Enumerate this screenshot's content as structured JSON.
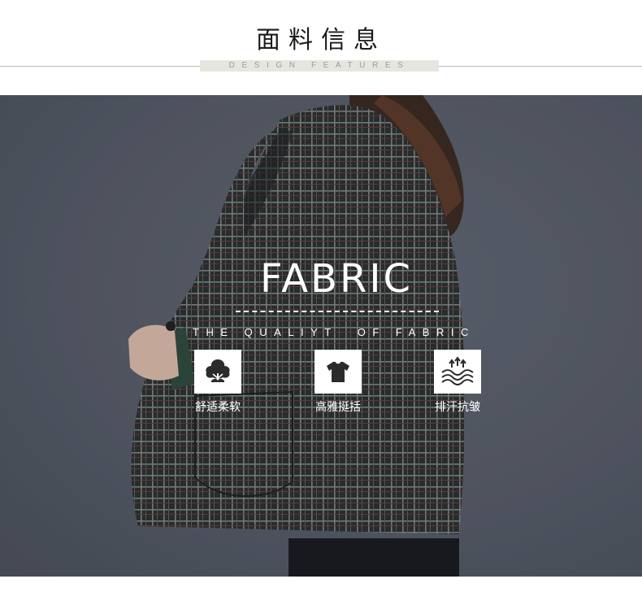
{
  "header": {
    "title": "面料信息",
    "subtitle": "DESIGN FEATURES"
  },
  "banner": {
    "headline": "FABRIC",
    "tagline": "THE QUALIYT  OF FABRIC",
    "features": [
      {
        "label": "舒适柔软",
        "icon": "tree-icon"
      },
      {
        "label": "高雅挺括",
        "icon": "tshirt-icon"
      },
      {
        "label": "排汗抗皱",
        "icon": "wave-arrows-icon"
      }
    ]
  },
  "colors": {
    "background": "#ffffff",
    "banner_background": "#565c68",
    "jacket": "#2d3132",
    "text_on_banner": "#ffffff",
    "icon_fill": "#2b2b2b"
  }
}
